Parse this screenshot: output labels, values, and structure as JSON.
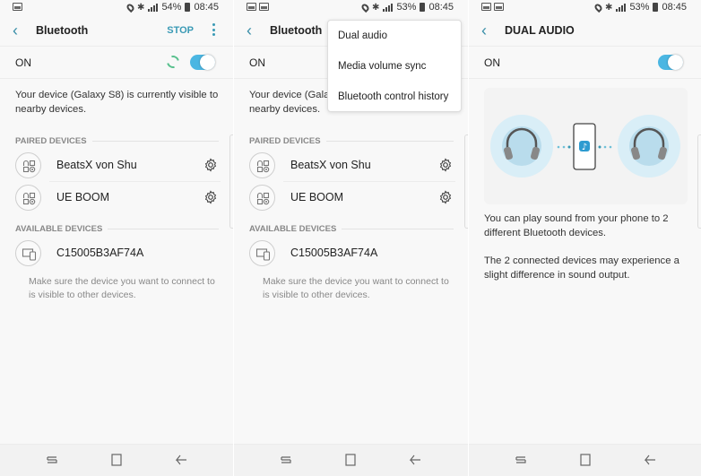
{
  "screens": [
    {
      "status": {
        "battery": "54%",
        "time": "08:45"
      },
      "appbar": {
        "title": "Bluetooth",
        "action": "STOP"
      },
      "toggle": {
        "label": "ON",
        "state": "on",
        "scanning": true
      },
      "visibility_text": "Your device (Galaxy S8) is currently visible to nearby devices.",
      "paired_header": "PAIRED DEVICES",
      "paired": [
        {
          "name": "BeatsX von Shu",
          "icon": "headset-speaker-icon"
        },
        {
          "name": "UE BOOM",
          "icon": "headset-speaker-icon"
        }
      ],
      "available_header": "AVAILABLE DEVICES",
      "available": [
        {
          "name": "C15005B3AF74A",
          "icon": "monitor-phone-icon"
        }
      ],
      "hint": "Make sure the device you want to connect to is visible to other devices."
    },
    {
      "status": {
        "battery": "53%",
        "time": "08:45"
      },
      "appbar": {
        "title": "Bluetooth"
      },
      "toggle": {
        "label": "ON"
      },
      "visibility_text": "Your device (Galaxy S8) is currently visible to nearby devices.",
      "paired_header": "PAIRED DEVICES",
      "paired": [
        {
          "name": "BeatsX von Shu"
        },
        {
          "name": "UE BOOM"
        }
      ],
      "available_header": "AVAILABLE DEVICES",
      "available": [
        {
          "name": "C15005B3AF74A"
        }
      ],
      "hint": "Make sure the device you want to connect to is visible to other devices.",
      "menu": [
        "Dual audio",
        "Media volume sync",
        "Bluetooth control history"
      ]
    },
    {
      "status": {
        "battery": "53%",
        "time": "08:45"
      },
      "appbar": {
        "title": "DUAL AUDIO"
      },
      "toggle": {
        "label": "ON",
        "state": "on"
      },
      "description": [
        "You can play sound from your phone to 2 different Bluetooth devices.",
        "The 2 connected devices may experience a slight difference in sound output."
      ]
    }
  ],
  "colors": {
    "accent": "#3a9ab5",
    "toggle_on": "#4bb6e2",
    "spinner": "#58c08d"
  }
}
